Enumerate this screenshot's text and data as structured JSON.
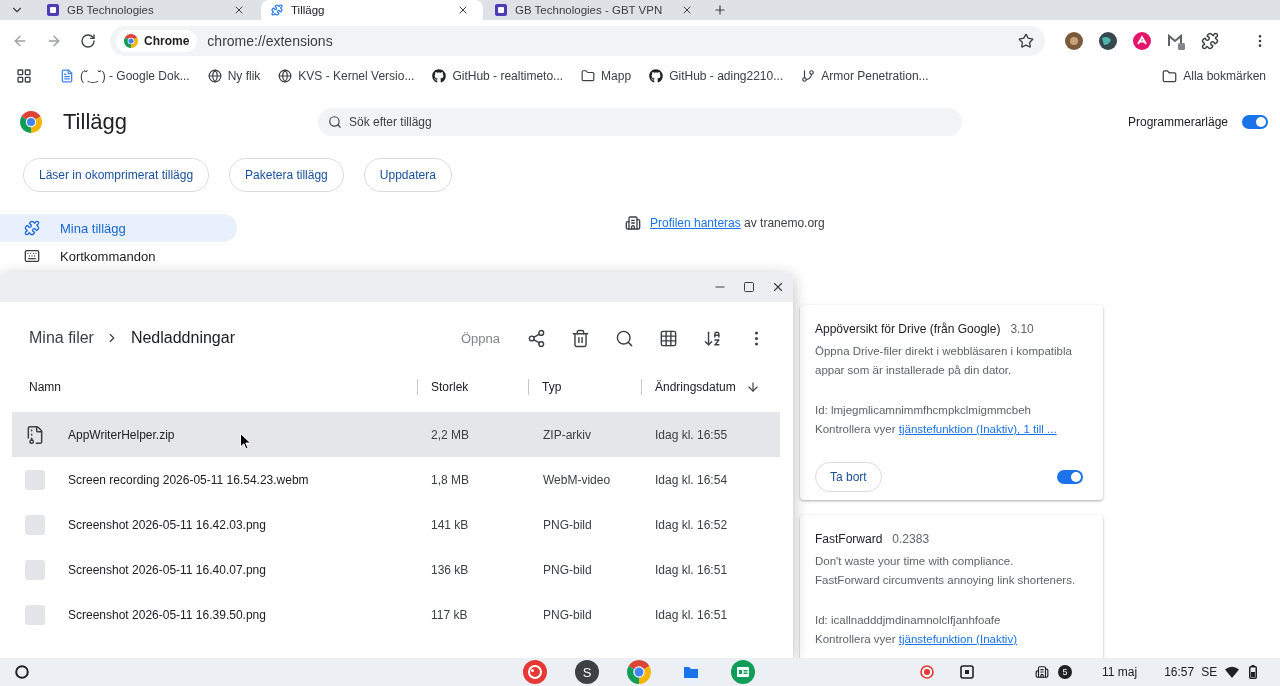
{
  "browser": {
    "tabs": [
      {
        "kind": "site",
        "title": "GB Technologies",
        "selected": false
      },
      {
        "kind": "extensions",
        "title": "Tillägg",
        "selected": true
      },
      {
        "kind": "site",
        "title": "GB Technologies - GBT VPN",
        "selected": false
      }
    ],
    "address_bar": {
      "chip": "Chrome",
      "url": "chrome://extensions"
    },
    "bookmarks": [
      {
        "kind": "doc",
        "label": "(˘‿˘) - Google Dok..."
      },
      {
        "kind": "globe",
        "label": "Ny flik"
      },
      {
        "kind": "globe",
        "label": "KVS - Kernel Versio..."
      },
      {
        "kind": "github",
        "label": "GitHub - realtimeto..."
      },
      {
        "kind": "folder",
        "label": "Mapp"
      },
      {
        "kind": "github",
        "label": "GitHub - ading2210..."
      },
      {
        "kind": "branch",
        "label": "Armor Penetration..."
      }
    ],
    "all_bookmarks": "Alla bokmärken"
  },
  "extensions_page": {
    "title": "Tillägg",
    "search": {
      "placeholder": "Sök efter tillägg"
    },
    "developer_mode": {
      "label": "Programmerarläge",
      "on": true
    },
    "actions": [
      "Läser in okomprimerat tillägg",
      "Paketera tillägg",
      "Uppdatera"
    ],
    "sidebar": [
      {
        "kind": "extensions",
        "label": "Mina tillägg",
        "selected": true
      },
      {
        "kind": "keyboard",
        "label": "Kortkommandon",
        "selected": false
      }
    ],
    "managed_notice": {
      "link": "Profilen hanteras",
      "text": "av tranemo.org"
    },
    "extensions": [
      {
        "name": "Appöversikt för Drive (från Google)",
        "version": "3.10",
        "description": "Öppna Drive-filer direkt i webbläsaren i kompatibla appar som är installerade på din dator.",
        "id": "Id: lmjegmlicamnimmfhcmpkclmigmmcbeh",
        "inspect_label": "Kontrollera vyer",
        "inspect_link": "tjänstefunktion (Inaktiv), 1 till ...",
        "remove": "Ta bort",
        "enabled": true
      },
      {
        "name": "FastForward",
        "version": "0.2383",
        "description": "Don't waste your time with compliance. FastForward circumvents annoying link shorteners.",
        "id": "Id: icallnadddjmdinamnolclfjanhfoafe",
        "inspect_label": "Kontrollera vyer",
        "inspect_link": "tjänstefunktion (Inaktiv)"
      }
    ]
  },
  "files_window": {
    "breadcrumb": [
      "Mina filer",
      "Nedladdningar"
    ],
    "open_label": "Öppna",
    "columns": [
      {
        "label": "Namn",
        "sorted": false
      },
      {
        "label": "Storlek",
        "sorted": false
      },
      {
        "label": "Typ",
        "sorted": false
      },
      {
        "label": "Ändringsdatum",
        "sorted": true
      }
    ],
    "rows": [
      {
        "kind": "archive",
        "name": "AppWriterHelper.zip",
        "size": "2,2 MB",
        "type": "ZIP-arkiv",
        "modified": "Idag kl. 16:55",
        "selected": true
      },
      {
        "kind": "video",
        "name": "Screen recording 2026-05-11 16.54.23.webm",
        "size": "1,8 MB",
        "type": "WebM-video",
        "modified": "Idag kl. 16:54",
        "selected": false
      },
      {
        "kind": "image",
        "name": "Screenshot 2026-05-11 16.42.03.png",
        "size": "141 kB",
        "type": "PNG-bild",
        "modified": "Idag kl. 16:52",
        "selected": false
      },
      {
        "kind": "image",
        "name": "Screenshot 2026-05-11 16.40.07.png",
        "size": "136 kB",
        "type": "PNG-bild",
        "modified": "Idag kl. 16:51",
        "selected": false
      },
      {
        "kind": "image",
        "name": "Screenshot 2026-05-11 16.39.50.png",
        "size": "117 kB",
        "type": "PNG-bild",
        "modified": "Idag kl. 16:51",
        "selected": false
      }
    ]
  },
  "shelf": {
    "apps": [
      {
        "kind": "paint"
      },
      {
        "kind": "letter",
        "label": "S"
      },
      {
        "kind": "chrome"
      },
      {
        "kind": "files"
      },
      {
        "kind": "classroom"
      }
    ],
    "notification_count": "5",
    "date": "11 maj",
    "time": "16:57",
    "region": "SE"
  }
}
